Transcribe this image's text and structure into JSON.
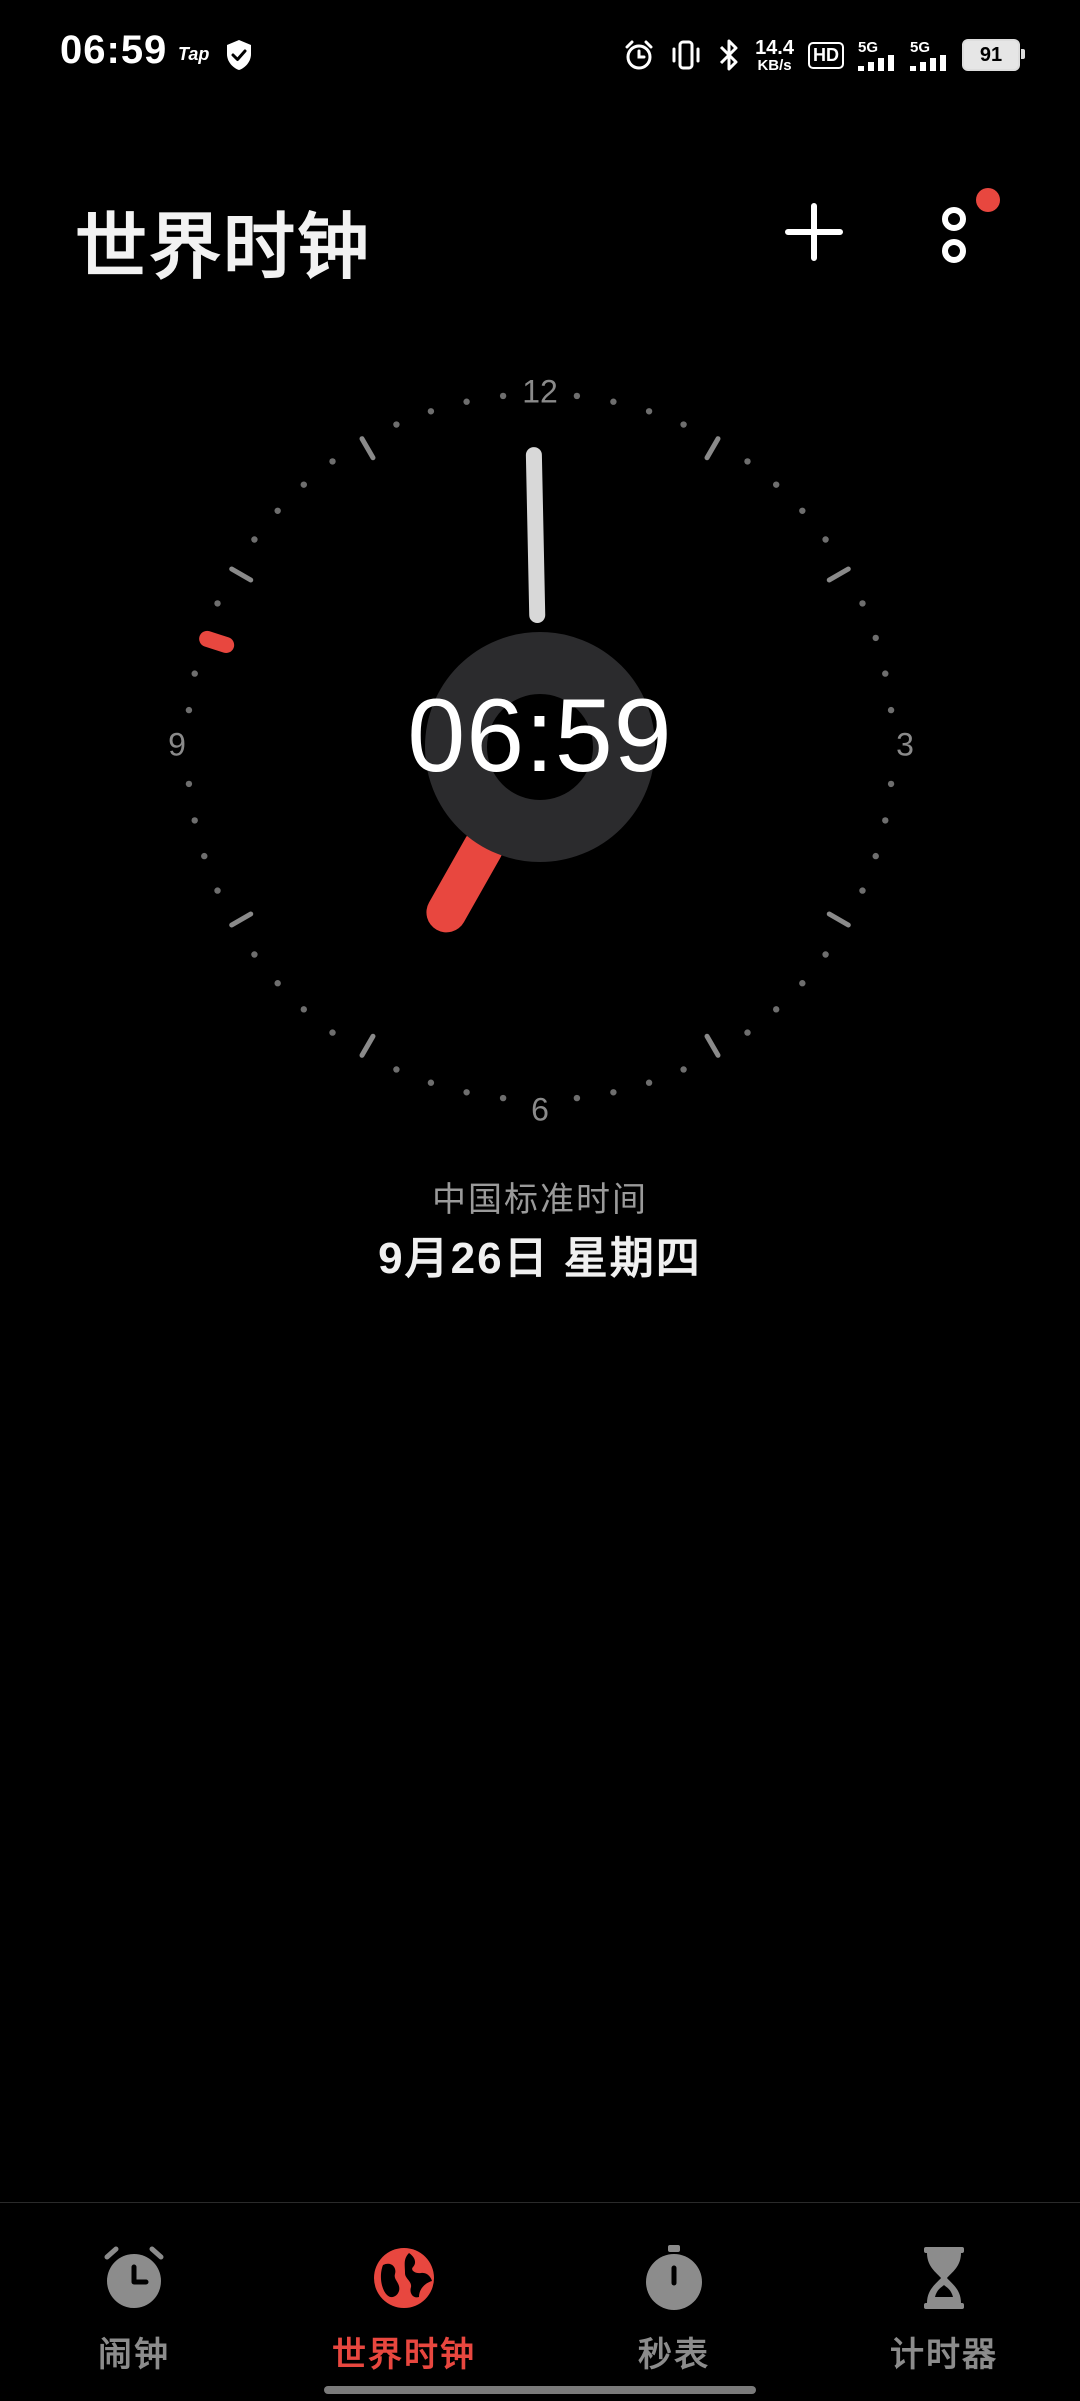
{
  "status_bar": {
    "time": "06:59",
    "app_badge": "Tap",
    "net_speed_value": "14.4",
    "net_speed_unit": "KB/s",
    "hd_label": "HD",
    "sig1": "5G",
    "sig2": "5G",
    "battery": "91"
  },
  "header": {
    "title": "世界时钟"
  },
  "clock": {
    "digital_time": "06:59",
    "num_12": "12",
    "num_3": "3",
    "num_6": "6",
    "num_9": "9",
    "hour": 6,
    "minute": 59,
    "second": 48,
    "accent_color": "#e8473f"
  },
  "zone": {
    "name": "中国标准时间",
    "date": "9月26日  星期四"
  },
  "nav": {
    "items": [
      {
        "label": "闹钟",
        "icon": "alarm-clock-icon"
      },
      {
        "label": "世界时钟",
        "icon": "globe-icon"
      },
      {
        "label": "秒表",
        "icon": "stopwatch-icon"
      },
      {
        "label": "计时器",
        "icon": "hourglass-icon"
      }
    ],
    "active_index": 1
  }
}
